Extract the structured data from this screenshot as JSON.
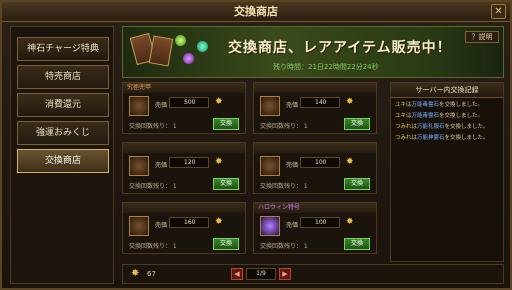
{
  "window": {
    "title": "交換商店",
    "close_label": "✕"
  },
  "sidebar": {
    "items": [
      {
        "label": "神石チャージ特典",
        "active": false
      },
      {
        "label": "特売商店",
        "active": false
      },
      {
        "label": "消費還元",
        "active": false
      },
      {
        "label": "強運おみくじ",
        "active": false
      },
      {
        "label": "交換商店",
        "active": true
      }
    ]
  },
  "banner": {
    "title": "交換商店、レアアイテム販売中！",
    "time": "残り時間：21日22時間22分24秒",
    "help_label": "？説明"
  },
  "items": [
    {
      "name": "究極兜甲",
      "price_label": "売価",
      "price": "500",
      "remain": "交換回数残り： 1",
      "button": "交換",
      "name_color": "orange"
    },
    {
      "name": "",
      "price_label": "売価",
      "price": "140",
      "remain": "交換回数残り： 1",
      "button": "交換",
      "name_color": "blue"
    },
    {
      "name": "",
      "price_label": "売価",
      "price": "120",
      "remain": "交換回数残り： 1",
      "button": "交換",
      "name_color": "blue"
    },
    {
      "name": "",
      "price_label": "売価",
      "price": "100",
      "remain": "交換回数残り： 1",
      "button": "交換",
      "name_color": "blue"
    },
    {
      "name": "",
      "price_label": "売価",
      "price": "160",
      "remain": "交換回数残り： 1",
      "button": "交換",
      "name_color": "blue"
    },
    {
      "name": "ハロウィン特号",
      "price_label": "売価",
      "price": "100",
      "remain": "交換回数残り： 1",
      "button": "交換",
      "name_color": "purple"
    }
  ],
  "log": {
    "title": "サーバー内交換記録",
    "entries": [
      {
        "user": "ユキ",
        "text": "は",
        "item": "万能毒霊石",
        "suffix": "を交換しました。"
      },
      {
        "user": "ユキ",
        "text": "は",
        "item": "万能毒霊石",
        "suffix": "を交換しました。"
      },
      {
        "user": "つみれ",
        "text": "は",
        "item": "万能礼服石",
        "suffix": "を交換しました。"
      },
      {
        "user": "つみれ",
        "text": "は",
        "item": "万能神霊石",
        "suffix": "を交換しました。"
      }
    ]
  },
  "footer": {
    "coin_count": "67",
    "page": "1/9",
    "prev_label": "◀",
    "next_label": "▶"
  },
  "colors": {
    "accent": "#d8b060",
    "button_green": "#3a8a2a",
    "gold": "#f0c040"
  }
}
